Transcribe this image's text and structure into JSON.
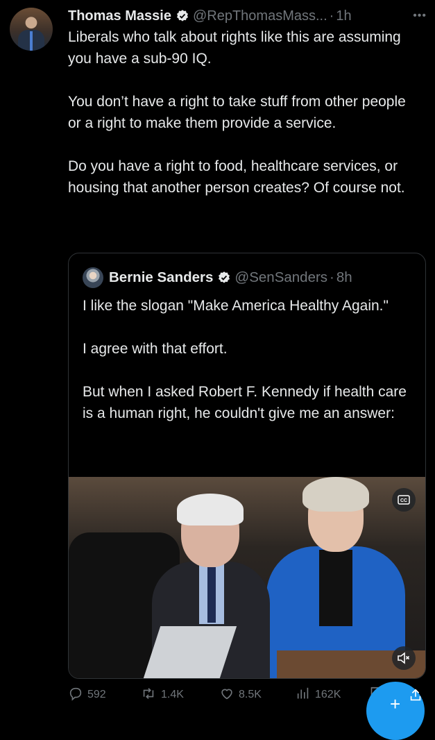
{
  "author": {
    "name": "Thomas Massie",
    "handle": "@RepThomasMass...",
    "separator": "·",
    "time": "1h"
  },
  "tweet": {
    "paragraphs": [
      "Liberals who talk about rights like this are assuming you have a sub-90 IQ.",
      "You don’t have a right to take stuff from other people or a right to make them provide a service.",
      "Do you have a right to food, healthcare services, or housing that another person creates? Of course not."
    ]
  },
  "quote": {
    "name": "Bernie Sanders",
    "handle": "@SenSanders",
    "separator": "·",
    "time": "8h",
    "paragraphs": [
      "I like the slogan \"Make America Healthy Again.\"",
      "I agree with that effort.",
      "But when I asked Robert F. Kennedy if health care is a human right, he couldn't give me an answer:"
    ]
  },
  "actions": {
    "replies": "592",
    "reposts": "1.4K",
    "likes": "8.5K",
    "views": "162K"
  },
  "icons": {
    "more": "more-icon",
    "verified": "verified-badge-icon",
    "captions": "closed-captions-icon",
    "mute": "muted-speaker-icon",
    "reply": "reply-icon",
    "repost": "repost-icon",
    "like": "heart-icon",
    "views": "views-chart-icon",
    "bookmark": "bookmark-icon",
    "share": "share-icon",
    "compose": "plus-icon"
  },
  "colors": {
    "background": "#000000",
    "text": "#e7e9ea",
    "secondary": "#71767b",
    "accent": "#1d9bf0"
  }
}
